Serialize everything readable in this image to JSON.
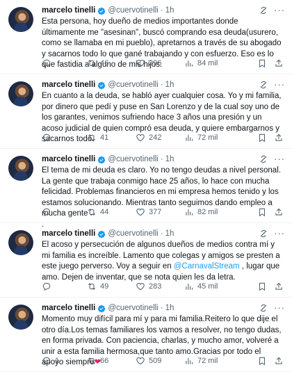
{
  "author": {
    "name": "marcelo tinelli",
    "handle": "@cuervotinelli",
    "time": "1h"
  },
  "icons": {
    "verified": "verified-badge-icon",
    "grok": "grok-icon",
    "more": "more-icon",
    "reply": "reply-icon",
    "retweet": "retweet-icon",
    "like": "like-icon",
    "views": "views-icon",
    "bookmark": "bookmark-icon",
    "share": "share-icon"
  },
  "colors": {
    "link": "#1d9bf0",
    "verified": "#1d9bf0",
    "heart": "#e0245e",
    "muted": "#536471"
  },
  "tweets": [
    {
      "text": "Esta persona, hoy dueño de medios importantes donde últimamente me \"asesinan\", buscó comprando esa deuda(usurero, como se llamaba en mi pueblo), apretarnos a través de su abogado y sacarnos todo lo que gané trabajando y con esfuerzo. Eso es lo que fastidia a alguno de mis hijos.",
      "replies": "",
      "retweets": "46",
      "likes": "296",
      "views": "84 mil"
    },
    {
      "text": "En cuanto a la deuda, se habló ayer cualquier cosa. Yo y mi familia, por dinero que pedí y puse en San Lorenzo y de la cual soy uno de los garantes, venimos sufriendo hace 3 años una presión y un acoso judicial de quien compró esa deuda, y quiere embargarnos y sacarnos todo.",
      "replies": "",
      "retweets": "41",
      "likes": "242",
      "views": "72 mil"
    },
    {
      "text": "El tema de mi deuda es claro. Yo no tengo deudas a nivel personal.\nLa gente que trabaja conmigo hace 25 años, lo  hace con mucha felicidad. Problemas financieros en  mi empresa hemos tenido y los estamos solucionando. Mientras tanto seguimos  dando empleo a mucha gente .\n.",
      "replies": "",
      "retweets": "44",
      "likes": "377",
      "views": "82 mil"
    },
    {
      "text_before": "El acoso y persecución de algunos dueños de medios contra mí y mi familia es increíble. Lamento que colegas y amigos se presten a este juego perverso. Voy a seguir en ",
      "mention": "@CarnavalStream",
      "text_after": " , lugar que amo. Dejen de inventar, que se nota quien les da letra.",
      "replies": "",
      "retweets": "49",
      "likes": "283",
      "views": "45 mil"
    },
    {
      "text": "Momento muy difícil para mí y para mi familia.Reitero lo que dije el otro día.Los temas familiares los vamos a resolver, no tengo dudas, en forma privada. Con paciencia, charlas, y mucho amor, volveré a unir a esta familia hermosa,que tanto amo.Gracias por todo el apoyo siempre",
      "emoji": "❤",
      "replies": "1",
      "retweets": "66",
      "likes": "509",
      "views": "72 mil"
    }
  ]
}
